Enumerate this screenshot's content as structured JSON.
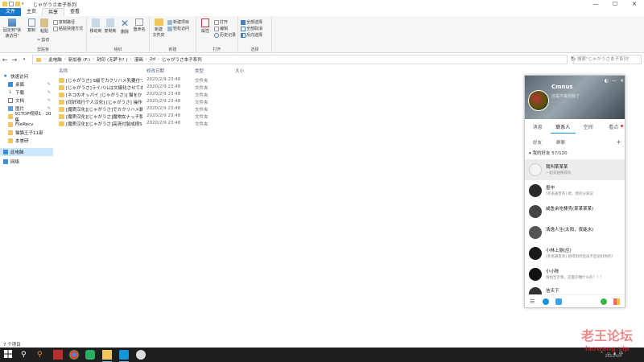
{
  "window": {
    "title": "じゃがうさ本子系列",
    "controls": {
      "minimize": "—",
      "maximize": "☐",
      "close": "✕"
    }
  },
  "ribbon_tabs": [
    "文件",
    "主页",
    "共享",
    "查看"
  ],
  "ribbon": {
    "clipboard": {
      "pin_label": "固定到\"快速访问\"",
      "copy_label": "复制",
      "paste_label": "粘贴",
      "copy_path_label": "复制路径",
      "paste_shortcut_label": "粘贴快捷方式",
      "cut_label": "剪切",
      "group_label": "剪贴板"
    },
    "organize": {
      "move_label": "移动到",
      "copyto_label": "复制到",
      "delete_label": "删除",
      "rename_label": "重命名",
      "group_label": "组织"
    },
    "new": {
      "new_folder_label": "新建\n文件夹",
      "new_item_label": "新建项目",
      "easy_access_label": "轻松访问",
      "group_label": "新建"
    },
    "open": {
      "properties_label": "属性",
      "open_label": "打开",
      "edit_label": "编辑",
      "history_label": "历史记录",
      "group_label": "打开"
    },
    "select": {
      "select_all_label": "全部选择",
      "select_none_label": "全部取消",
      "invert_label": "反向选择",
      "group_label": "选择"
    }
  },
  "address": {
    "crumbs": [
      "此电脑",
      "新加卷 (F:)",
      "封印 (无萨卡? )",
      "漫画",
      "2d",
      "じゃがうさ本子系列"
    ],
    "search_placeholder": "搜索\"じゃがうさ本子系列\""
  },
  "nav_pane": {
    "items": [
      {
        "label": "快速访问",
        "pinned": false
      },
      {
        "label": "桌面",
        "pinned": true
      },
      {
        "label": "下载",
        "pinned": true
      },
      {
        "label": "文档",
        "pinned": true
      },
      {
        "label": "图片",
        "pinned": true
      },
      {
        "label": "91TOP视频1 · 20集",
        "pinned": false
      },
      {
        "label": "FileRecv",
        "pinned": false
      },
      {
        "label": "猫猫王子11部",
        "pinned": false
      },
      {
        "label": "本崽研",
        "pinned": false
      },
      {
        "label": "此电脑",
        "pinned": false
      },
      {
        "label": "网络",
        "pinned": false
      }
    ]
  },
  "file_list": {
    "columns": {
      "name": "名称",
      "date": "修改日期",
      "type": "类型",
      "size": "大小"
    },
    "rows": [
      {
        "name": "[じゃがうさ] S級でカクリハメ乳要付つ...",
        "date": "2020/2/9 23:48",
        "type": "文件夹"
      },
      {
        "name": "[じゃがうさ]ライバルは文鎮化させて本...",
        "date": "2020/2/9 23:48",
        "type": "文件夹"
      },
      {
        "name": "[ネコのオッパイ (じゃがうさ)] 猫をかけ...",
        "date": "2020/2/9 23:48",
        "type": "文件夹"
      },
      {
        "name": "[同好戏行个人汉化] [じゃがうさ] 操作",
        "date": "2020/2/9 23:48",
        "type": "文件夹"
      },
      {
        "name": "[魔质汉化][じゃがうさ]でカクリハメ観...",
        "date": "2020/2/9 23:48",
        "type": "文件夹"
      },
      {
        "name": "[魔质汉化][じゃがうさ]魔物女ナッチ製...",
        "date": "2020/2/9 23:48",
        "type": "文件夹"
      },
      {
        "name": "[魔质汉化][じゃがうさ]高清付製成様SE...",
        "date": "2020/2/9 23:48",
        "type": "文件夹"
      }
    ]
  },
  "status_bar": {
    "count": "7 个项目"
  },
  "qq": {
    "nickname": "Cmnus",
    "signature": "还是不来找我了",
    "tabs": [
      "消息",
      "联系人",
      "空间",
      "看点"
    ],
    "subtabs": [
      "好友",
      "群聊"
    ],
    "plus": "+",
    "group": "我的好友 57/120",
    "contacts": [
      {
        "name": "我叫某某某",
        "status": "一起去拍照得乐"
      },
      {
        "name": "墨中",
        "status": "[英语通晋英] 嗯，我的分离说"
      },
      {
        "name": "咸鱼余吃棒壳(某某某某)",
        "status": ""
      },
      {
        "name": "清逸人生(太阳，夜能水)",
        "status": ""
      },
      {
        "name": "小林上厨(应)",
        "status": "[英语通晋英] 想得到然后再不后说好你的！"
      },
      {
        "name": "小小陈",
        "status": "请相至示我，店面店槽什么的！！！"
      },
      {
        "name": "信天下",
        "status": ""
      }
    ]
  },
  "taskbar": {
    "clock_time": "",
    "clock_date": "2022/4/9"
  },
  "watermark": {
    "line1": "老王论坛",
    "line2": "laowang.vip"
  },
  "colors": {
    "accent": "#1979ca",
    "folder": "#f1c75b",
    "selection": "#cce8ff",
    "qq_accent": "#1296db"
  }
}
